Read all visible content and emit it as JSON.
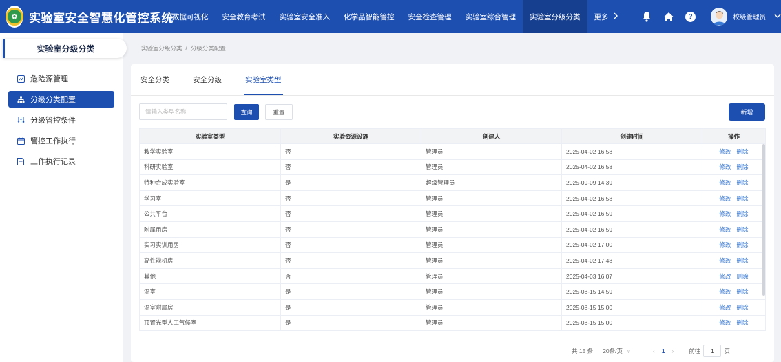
{
  "header": {
    "app_title": "实验室安全智慧化管控系统",
    "logo_icon": "university-seal-logo",
    "nav": [
      {
        "label": "数据可视化"
      },
      {
        "label": "安全教育考试"
      },
      {
        "label": "实验室安全准入"
      },
      {
        "label": "化学品智能管控"
      },
      {
        "label": "安全检查管理"
      },
      {
        "label": "实验室综合管理"
      },
      {
        "label": "实验室分级分类",
        "active": true
      }
    ],
    "more_label": "更多",
    "user_name": "校级管理员",
    "brand_color": "#1d4fb0"
  },
  "sidebar": {
    "title": "实验室分级分类",
    "items": [
      {
        "label": "危险源管理",
        "icon": "chart-icon"
      },
      {
        "label": "分级分类配置",
        "icon": "hierarchy-icon",
        "active": true
      },
      {
        "label": "分级管控条件",
        "icon": "sliders-icon"
      },
      {
        "label": "管控工作执行",
        "icon": "calendar-icon"
      },
      {
        "label": "工作执行记录",
        "icon": "document-icon"
      }
    ]
  },
  "breadcrumb": {
    "root": "实验室分级分类",
    "sep": "/",
    "current": "分级分类配置"
  },
  "tabs": [
    {
      "label": "安全分类"
    },
    {
      "label": "安全分级"
    },
    {
      "label": "实验室类型",
      "active": true
    }
  ],
  "search": {
    "placeholder": "请输入类型名称",
    "query_label": "查询",
    "reset_label": "重置",
    "add_label": "新增"
  },
  "table": {
    "headers": [
      "实验室类型",
      "实验资源设施",
      "创建人",
      "创建时间",
      "操作"
    ],
    "edit_label": "修改",
    "delete_label": "删除",
    "rows": [
      {
        "type": "教学实验室",
        "facility": "否",
        "creator": "管理员",
        "time": "2025-04-02 16:58"
      },
      {
        "type": "科研实验室",
        "facility": "否",
        "creator": "管理员",
        "time": "2025-04-02 16:58"
      },
      {
        "type": "特种合成实验室",
        "facility": "是",
        "creator": "超级管理员",
        "time": "2025-09-09 14:39"
      },
      {
        "type": "学习室",
        "facility": "否",
        "creator": "管理员",
        "time": "2025-04-02 16:58"
      },
      {
        "type": "公共平台",
        "facility": "否",
        "creator": "管理员",
        "time": "2025-04-02 16:59"
      },
      {
        "type": "附属用房",
        "facility": "否",
        "creator": "管理员",
        "time": "2025-04-02 16:59"
      },
      {
        "type": "实习实训用房",
        "facility": "否",
        "creator": "管理员",
        "time": "2025-04-02 17:00"
      },
      {
        "type": "高性能机房",
        "facility": "否",
        "creator": "管理员",
        "time": "2025-04-02 17:48"
      },
      {
        "type": "其他",
        "facility": "否",
        "creator": "管理员",
        "time": "2025-04-03 16:07"
      },
      {
        "type": "温室",
        "facility": "是",
        "creator": "管理员",
        "time": "2025-08-15 14:59"
      },
      {
        "type": "温室附属房",
        "facility": "是",
        "creator": "管理员",
        "time": "2025-08-15 15:00"
      },
      {
        "type": "顶置光型人工气候室",
        "facility": "是",
        "creator": "管理员",
        "time": "2025-08-15 15:00"
      }
    ]
  },
  "pagination": {
    "total": "共 15 条",
    "page_size": "20条/页",
    "current_page": "1",
    "goto_label": "前往",
    "goto_value": "1",
    "page_unit": "页"
  }
}
